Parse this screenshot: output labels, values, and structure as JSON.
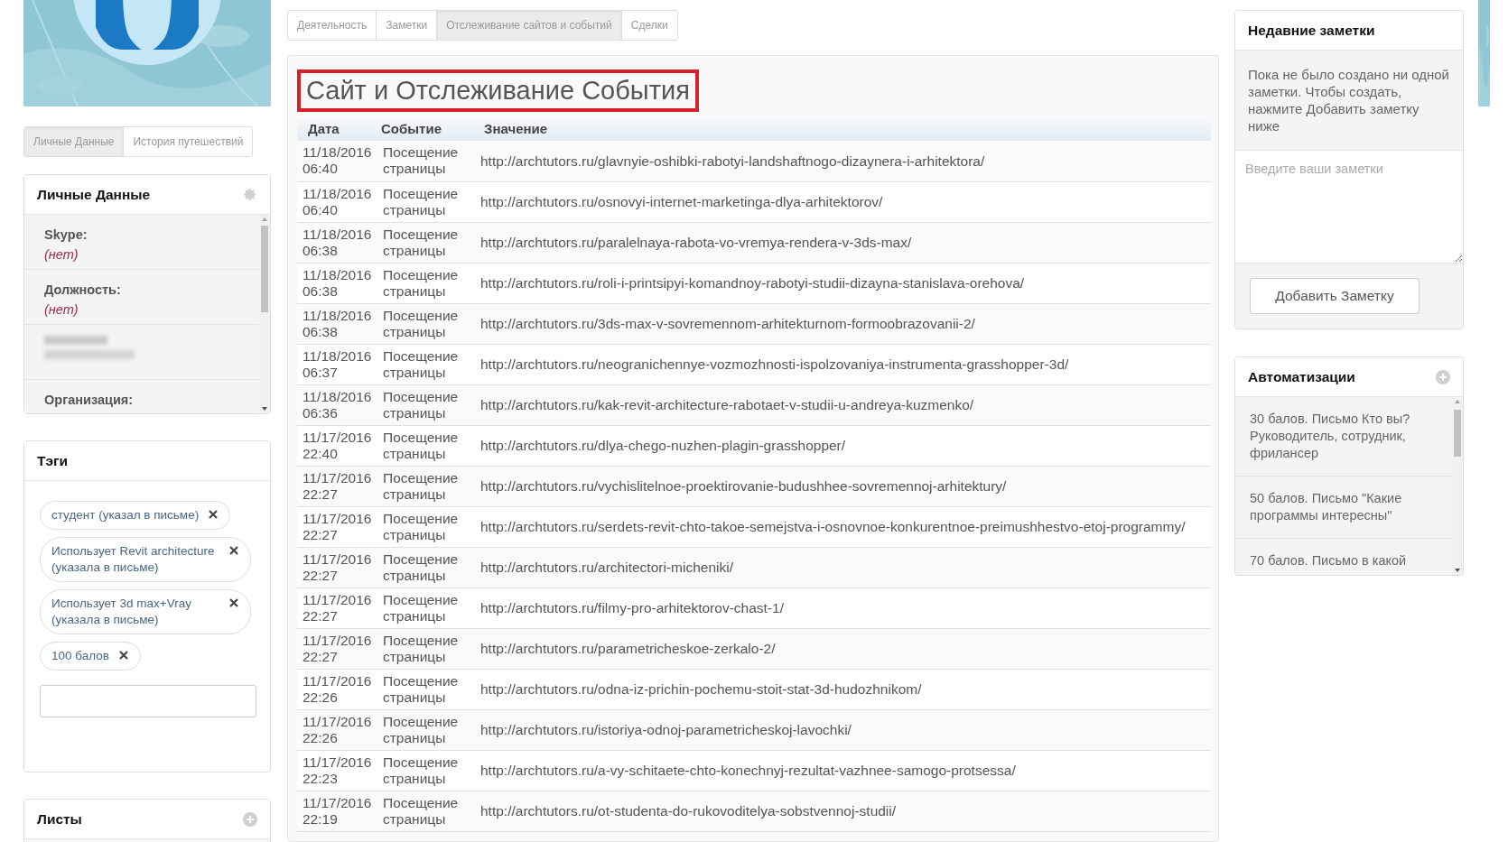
{
  "profile_tabs": [
    {
      "label": "Личные Данные",
      "selected": true
    },
    {
      "label": "История путешествий",
      "selected": false
    }
  ],
  "personal": {
    "title": "Личные Данные",
    "fields": [
      {
        "label": "Skype:",
        "value": "(нет)",
        "kind": "field"
      },
      {
        "label": "Должность:",
        "value": "(нет)",
        "kind": "field"
      },
      {
        "kind": "blurred"
      },
      {
        "label": "Организация:",
        "kind": "field"
      }
    ]
  },
  "tags": {
    "title": "Тэги",
    "items": [
      "студент (указал в письме)",
      "Использует Revit architecture (указала в письме)",
      "Использует 3d max+Vray (указала в письме)",
      "100 балов"
    ]
  },
  "lists": {
    "title": "Листы"
  },
  "main_tabs": [
    {
      "label": "Деятельность",
      "selected": false
    },
    {
      "label": "Заметки",
      "selected": false
    },
    {
      "label": "Отслеживание сайтов и событий",
      "selected": true
    },
    {
      "label": "Сделки",
      "selected": false
    }
  ],
  "events": {
    "title": "Сайт и Отслеживание События",
    "columns": [
      "Дата",
      "Событие",
      "Значение"
    ],
    "rows": [
      [
        "11/18/2016 06:40",
        "Посещение страницы",
        "http://archtutors.ru/glavnyie-oshibki-rabotyi-landshaftnogo-dizaynera-i-arhitektora/"
      ],
      [
        "11/18/2016 06:40",
        "Посещение страницы",
        "http://archtutors.ru/osnovyi-internet-marketinga-dlya-arhitektorov/"
      ],
      [
        "11/18/2016 06:38",
        "Посещение страницы",
        "http://archtutors.ru/paralelnaya-rabota-vo-vremya-rendera-v-3ds-max/"
      ],
      [
        "11/18/2016 06:38",
        "Посещение страницы",
        "http://archtutors.ru/roli-i-printsipyi-komandnoy-rabotyi-studii-dizayna-stanislava-orehova/"
      ],
      [
        "11/18/2016 06:38",
        "Посещение страницы",
        "http://archtutors.ru/3ds-max-v-sovremennom-arhitekturnom-formoobrazovanii-2/"
      ],
      [
        "11/18/2016 06:37",
        "Посещение страницы",
        "http://archtutors.ru/neogranichennye-vozmozhnosti-ispolzovaniya-instrumenta-grasshopper-3d/"
      ],
      [
        "11/18/2016 06:36",
        "Посещение страницы",
        "http://archtutors.ru/kak-revit-architecture-rabotaet-v-studii-u-andreya-kuzmenko/"
      ],
      [
        "11/17/2016 22:40",
        "Посещение страницы",
        "http://archtutors.ru/dlya-chego-nuzhen-plagin-grasshopper/"
      ],
      [
        "11/17/2016 22:27",
        "Посещение страницы",
        "http://archtutors.ru/vychislitelnoe-proektirovanie-budushhee-sovremennoj-arhitektury/"
      ],
      [
        "11/17/2016 22:27",
        "Посещение страницы",
        "http://archtutors.ru/serdets-revit-chto-takoe-semejstva-i-osnovnoe-konkurentnoe-preimushhestvo-etoj-programmy/"
      ],
      [
        "11/17/2016 22:27",
        "Посещение страницы",
        "http://archtutors.ru/architectori-micheniki/"
      ],
      [
        "11/17/2016 22:27",
        "Посещение страницы",
        "http://archtutors.ru/filmy-pro-arhitektorov-chast-1/"
      ],
      [
        "11/17/2016 22:27",
        "Посещение страницы",
        "http://archtutors.ru/parametricheskoe-zerkalo-2/"
      ],
      [
        "11/17/2016 22:26",
        "Посещение страницы",
        "http://archtutors.ru/odna-iz-prichin-pochemu-stoit-stat-3d-hudozhnikom/"
      ],
      [
        "11/17/2016 22:26",
        "Посещение страницы",
        "http://archtutors.ru/istoriya-odnoj-parametricheskoj-lavochki/"
      ],
      [
        "11/17/2016 22:23",
        "Посещение страницы",
        "http://archtutors.ru/a-vy-schitaete-chto-konechnyj-rezultat-vazhnee-samogo-protsessa/"
      ],
      [
        "11/17/2016 22:19",
        "Посещение страницы",
        "http://archtutors.ru/ot-studenta-do-rukovoditelya-sobstvennoj-studii/"
      ]
    ]
  },
  "notes": {
    "title": "Недавние заметки",
    "empty_text": "Пока не было создано ни одной заметки. Чтобы создать, нажмите Добавить заметку ниже",
    "placeholder": "Введите ваши заметки",
    "button": "Добавить Заметку"
  },
  "automations": {
    "title": "Автоматизации",
    "items": [
      "30 балов. Письмо Кто вы? Руководитель, сотрудник, фрилансер",
      "50 балов. Письмо \"Какие программы интересны\"",
      "70 балов. Письмо в какой"
    ]
  }
}
